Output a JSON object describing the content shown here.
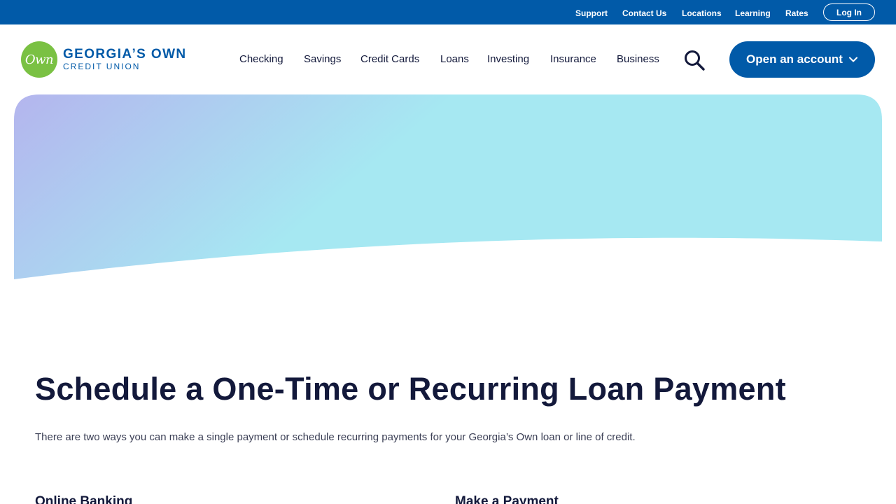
{
  "utility": {
    "links": [
      "Support",
      "Contact Us",
      "Locations",
      "Learning",
      "Rates"
    ],
    "login_label": "Log In"
  },
  "logo": {
    "mark_text": "Own",
    "line1": "GEORGIA’S OWN",
    "line2": "CREDIT UNION"
  },
  "nav": {
    "items": [
      "Checking",
      "Savings",
      "Credit Cards",
      "Loans",
      "Investing",
      "Insurance",
      "Business"
    ],
    "search_icon": "search-icon",
    "cta_label": "Open an account",
    "cta_icon": "chevron-down-icon"
  },
  "colors": {
    "brand_blue": "#015aa8",
    "logo_green": "#7ac143",
    "heading": "#13193b",
    "hero_gradient_start": "#b4b5ee",
    "hero_gradient_end": "#a6e8f2"
  },
  "main": {
    "title": "Schedule a One-Time or Recurring Loan Payment",
    "intro": "There are two ways you can make a single payment or schedule recurring payments for your Georgia’s Own loan or line of credit.",
    "sections": [
      "Online Banking",
      "Make a Payment"
    ]
  }
}
